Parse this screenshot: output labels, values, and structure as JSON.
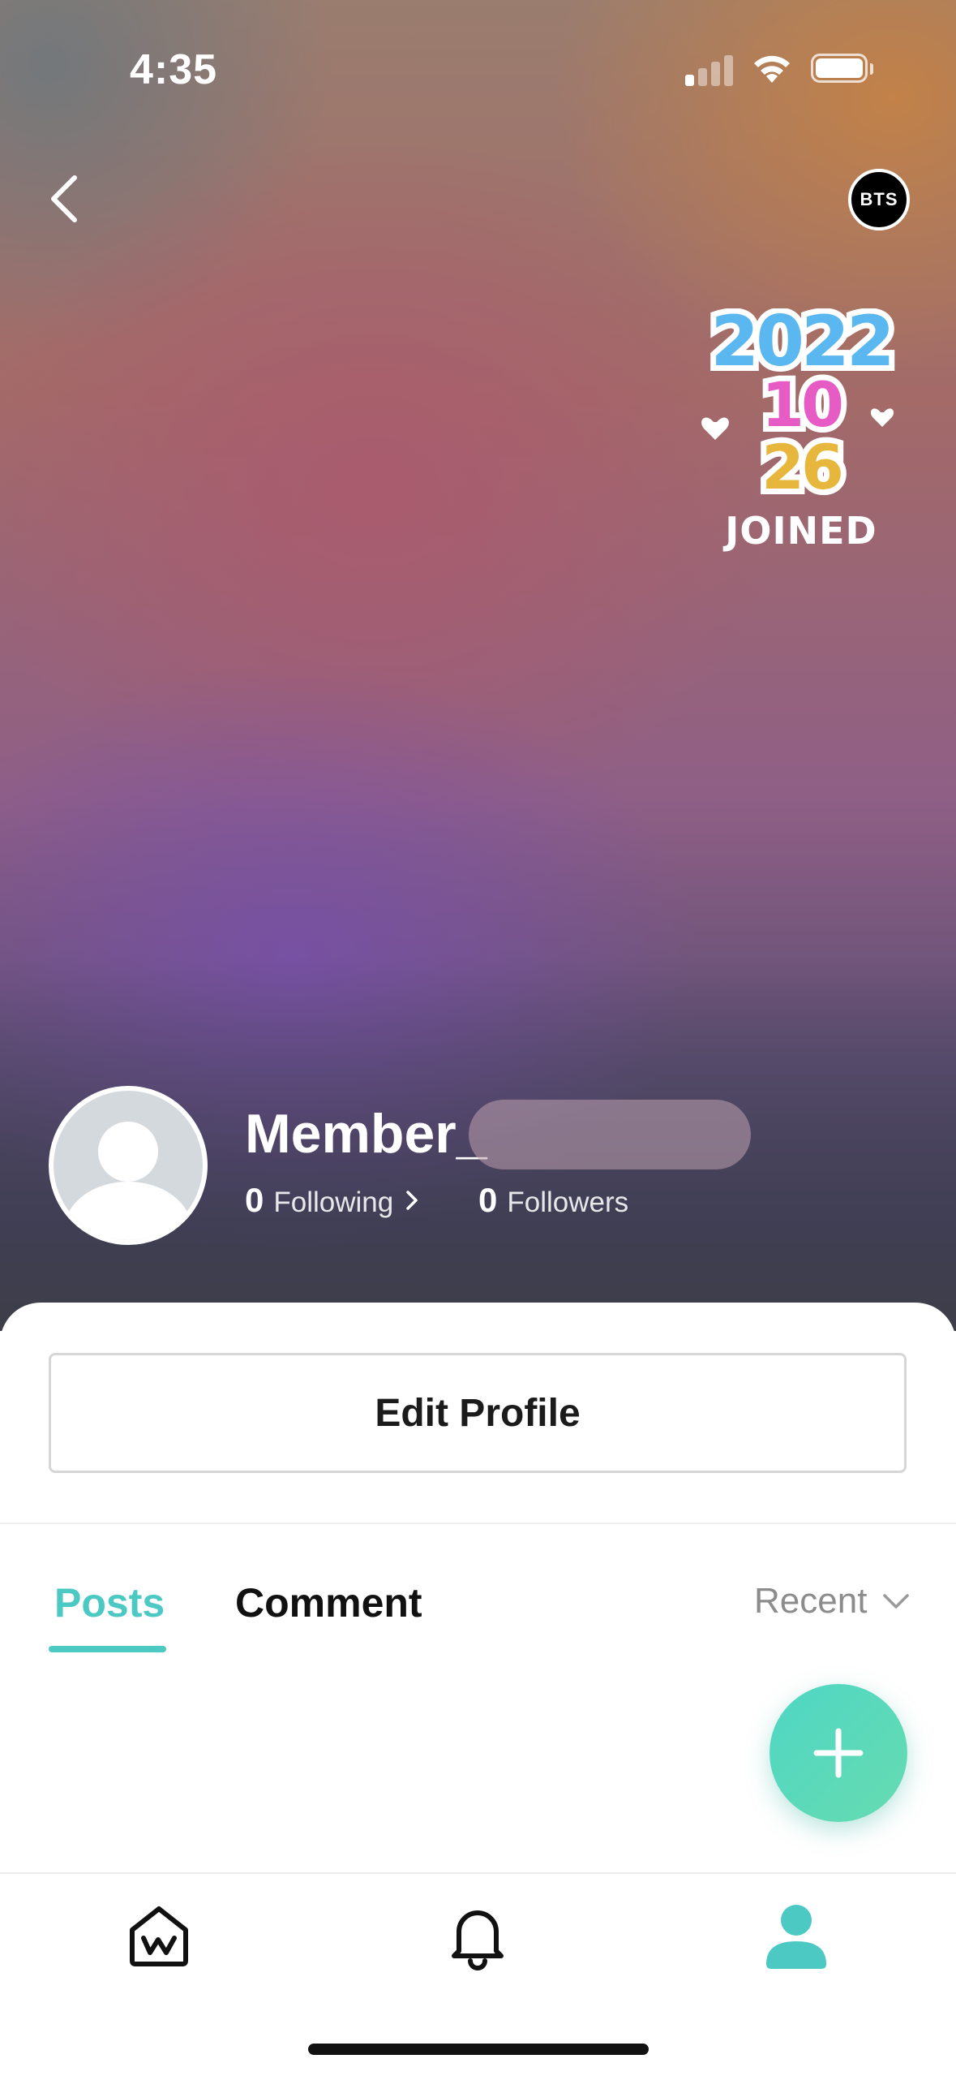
{
  "status_bar": {
    "time": "4:35",
    "icons": [
      "cellular-signal-icon",
      "wifi-icon",
      "battery-icon"
    ]
  },
  "header": {
    "back_icon": "chevron-left-icon",
    "community_badge": "BTS"
  },
  "joined_badge": {
    "year": "2022",
    "month": "10",
    "day": "26",
    "label": "JOINED",
    "colors": {
      "year": "#5ab7ef",
      "month": "#e65bc4",
      "day": "#e7b73d"
    }
  },
  "profile": {
    "name_prefix": "Member_",
    "following_count": "0",
    "following_label": "Following",
    "followers_count": "0",
    "followers_label": "Followers"
  },
  "actions": {
    "edit_profile_label": "Edit Profile"
  },
  "tabs": {
    "items": [
      {
        "label": "Posts",
        "active": true
      },
      {
        "label": "Comment",
        "active": false
      }
    ],
    "sort_label": "Recent"
  },
  "fab": {
    "icon": "plus-icon",
    "color": "#5ad8bd"
  },
  "bottom_nav": {
    "items": [
      {
        "icon": "weverse-home-icon",
        "active": false
      },
      {
        "icon": "bell-icon",
        "active": false
      },
      {
        "icon": "profile-icon",
        "active": true
      }
    ],
    "accent": "#4dc9c4"
  }
}
